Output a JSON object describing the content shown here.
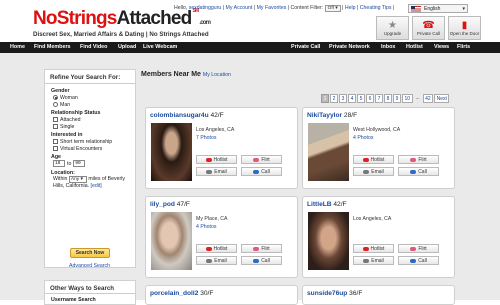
{
  "header": {
    "logo_a": "NoStrings",
    "logo_b": "Attached",
    "logo_sm": "SM",
    "logo_com": ".com",
    "tagline": "Discreet Sex, Married Affairs & Dating  |  No Strings Attached",
    "hello": "Hello,",
    "username": "sexdatingguru",
    "my_account": "My Account",
    "my_favorites": "My Favorites",
    "content_filter": "Content Filter:",
    "content_filter_value": "Off",
    "help": "Help",
    "cheating_tips": "Cheating Tips",
    "language": "English",
    "buttons": [
      {
        "label": "Upgrade",
        "icon": "star-icon"
      },
      {
        "label": "Private Call",
        "icon": "phone-icon"
      },
      {
        "label": "Open the Door",
        "icon": "door-icon"
      }
    ]
  },
  "nav": {
    "left": [
      "Home",
      "Find Members",
      "Find Video",
      "Upload",
      "Live Webcam"
    ],
    "right": [
      "Private Call",
      "Private Network",
      "Inbox",
      "Hotlist",
      "Views",
      "Flirts"
    ]
  },
  "sidebar": {
    "title": "Refine Your Search For:",
    "gender_label": "Gender",
    "gender_options": [
      "Woman",
      "Man"
    ],
    "relationship_label": "Relationship Status",
    "relationship_options": [
      "Attached",
      "Single"
    ],
    "interest_label": "Interested in",
    "interest_options": [
      "Short term relationship",
      "Virtual Encounters"
    ],
    "age_label": "Age",
    "age_from": "18",
    "age_to_word": "to",
    "age_to": "99",
    "location_label": "Location:",
    "within_word": "Within",
    "within_value": "Any",
    "location_text": "miles of Beverly Hills, California.",
    "edit": "[edit]",
    "search_button": "Search Now",
    "advanced": "Advanced Search"
  },
  "sidebar2": {
    "title": "Other Ways to Search",
    "username_label": "Username Search"
  },
  "members": {
    "title": "Members Near Me",
    "location_link": "My Location",
    "pages": [
      "1",
      "2",
      "3",
      "4",
      "5",
      "6",
      "7",
      "8",
      "9",
      "10",
      "...",
      "42",
      "Next"
    ],
    "actions": {
      "hotlist": "Hotlist",
      "flirt": "Flirt",
      "email": "Email",
      "call": "Call"
    },
    "cards": [
      {
        "name": "colombiansugar4u",
        "age_sex": "42/F",
        "city": "Los Angeles, CA",
        "photos": "7 Photos"
      },
      {
        "name": "NikiTayylor",
        "age_sex": "28/F",
        "city": "West Hollywood, CA",
        "photos": "4 Photos"
      },
      {
        "name": "lily_pod",
        "age_sex": "47/F",
        "city": "My Place, CA",
        "photos": "4 Photos"
      },
      {
        "name": "LittleLB",
        "age_sex": "42/F",
        "city": "Los Angeles, CA",
        "photos": ""
      },
      {
        "name": "porcelain_doll2",
        "age_sex": "30/F",
        "city": "",
        "photos": ""
      },
      {
        "name": "sunside76up",
        "age_sex": "36/F",
        "city": "",
        "photos": ""
      }
    ]
  },
  "colors": {
    "brand_red": "#dd1111",
    "nav_bg": "#1a1a1a",
    "link_blue": "#1a4a9e",
    "page_bg": "#eaeaea"
  }
}
